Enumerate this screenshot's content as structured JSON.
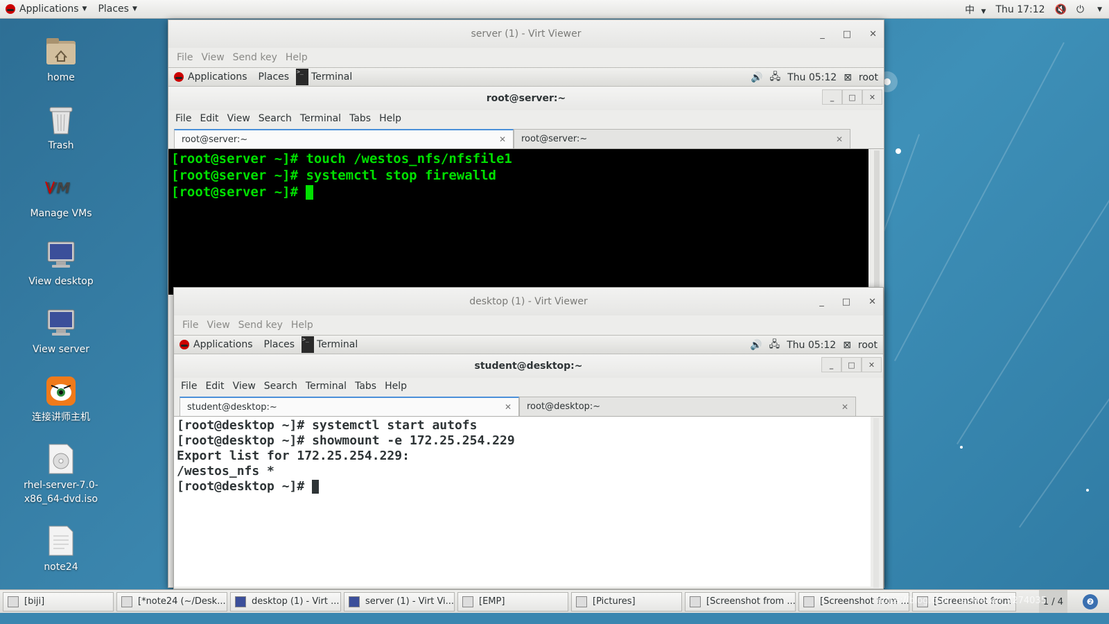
{
  "top_panel": {
    "applications": "Applications",
    "places": "Places",
    "input_method": "中",
    "clock": "Thu 17:12"
  },
  "desktop_icons": [
    {
      "label": "home",
      "icon": "home-folder-icon"
    },
    {
      "label": "Trash",
      "icon": "trash-icon"
    },
    {
      "label": "Manage VMs",
      "icon": "vmm-icon"
    },
    {
      "label": "View desktop",
      "icon": "monitor-icon"
    },
    {
      "label": "View server",
      "icon": "monitor-icon"
    },
    {
      "label": "连接讲师主机",
      "icon": "app-icon"
    },
    {
      "label": "rhel-server-7.0-x86_64-dvd.iso",
      "label1": "rhel-server-7.0-",
      "label2": "x86_64-dvd.iso",
      "icon": "disc-icon"
    },
    {
      "label": "note24",
      "icon": "document-icon"
    }
  ],
  "server_viewer": {
    "title": "server (1) - Virt Viewer",
    "menu": [
      "File",
      "View",
      "Send key",
      "Help"
    ],
    "guest_panel": {
      "applications": "Applications",
      "places": "Places",
      "task": "Terminal",
      "clock": "Thu 05:12",
      "user": "root"
    },
    "terminal": {
      "title": "root@server:~",
      "menu": [
        "File",
        "Edit",
        "View",
        "Search",
        "Terminal",
        "Tabs",
        "Help"
      ],
      "tabs": [
        "root@server:~",
        "root@server:~"
      ],
      "lines": [
        "[root@server ~]# touch /westos_nfs/nfsfile1",
        "[root@server ~]# systemctl stop firewalld",
        "[root@server ~]# "
      ]
    }
  },
  "desktop_viewer": {
    "title": "desktop (1) - Virt Viewer",
    "menu": [
      "File",
      "View",
      "Send key",
      "Help"
    ],
    "guest_panel": {
      "applications": "Applications",
      "places": "Places",
      "task": "Terminal",
      "clock": "Thu 05:12",
      "user": "root"
    },
    "terminal": {
      "title": "student@desktop:~",
      "menu": [
        "File",
        "Edit",
        "View",
        "Search",
        "Terminal",
        "Tabs",
        "Help"
      ],
      "tabs": [
        "student@desktop:~",
        "root@desktop:~"
      ],
      "lines": [
        "[root@desktop ~]# systemctl start autofs",
        "[root@desktop ~]# showmount -e 172.25.254.229",
        "Export list for 172.25.254.229:",
        "/westos_nfs *",
        "[root@desktop ~]# "
      ]
    }
  },
  "taskbar": {
    "items": [
      "[biji]",
      "[*note24 (~/Desk...",
      "desktop (1) - Virt ...",
      "server (1) - Virt Vi...",
      "[EMP]",
      "[Pictures]",
      "[Screenshot from ...",
      "[Screenshot from ...",
      "[Screenshot from ..."
    ],
    "workspace": "1 / 4",
    "watermark": "https://blog.csdn.net/weixin_4274035"
  },
  "colors": {
    "server_term_bg": "#000000",
    "server_term_fg": "#00e000",
    "desktop_term_bg": "#ffffff",
    "desktop_term_fg": "#2e3436",
    "wallpaper": "#3a85ad"
  }
}
